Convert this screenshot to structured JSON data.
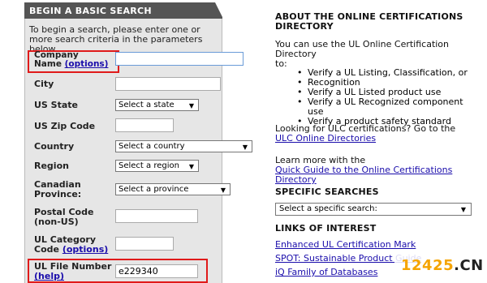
{
  "search_panel": {
    "header": "BEGIN A BASIC SEARCH",
    "intro": "To begin a search, please enter one or more search criteria in the parameters below.",
    "fields": {
      "company_name": {
        "label_line1": "Company",
        "label_line2": "Name",
        "link": "(options)",
        "value": ""
      },
      "city": {
        "label": "City",
        "value": ""
      },
      "us_state": {
        "label": "US State",
        "selected": "Select a state"
      },
      "us_zip": {
        "label": "US Zip Code",
        "value": ""
      },
      "country": {
        "label": "Country",
        "selected": "Select a country"
      },
      "region": {
        "label": "Region",
        "selected": "Select a region"
      },
      "canadian_province": {
        "label_line1": "Canadian",
        "label_line2": "Province:",
        "selected": "Select a province"
      },
      "postal_code": {
        "label_line1": "Postal Code",
        "label_line2": "(non-US)",
        "value": ""
      },
      "ul_category_code": {
        "label_line1": "UL Category",
        "label_line2": "Code",
        "link": "(options)",
        "value": ""
      },
      "ul_file_number": {
        "label": "UL File Number",
        "link": "(help)",
        "value": "e229340"
      }
    }
  },
  "about": {
    "title_line1": "ABOUT THE ONLINE CERTIFICATIONS",
    "title_line2": "DIRECTORY",
    "intro_line1": "You can use the UL Online Certification Directory",
    "intro_line2": "to:",
    "bullets": [
      "Verify a UL Listing, Classification, or",
      "Recognition",
      "Verify a UL Listed product use",
      "Verify a UL Recognized component use",
      "Verify a product safety standard"
    ],
    "ulc_text": "Looking for ULC certifications? Go to the",
    "ulc_link": "ULC Online Directories",
    "learn_text": "Learn more with the",
    "learn_link": "Quick Guide to the Online Certifications Directory"
  },
  "specific_searches": {
    "title": "SPECIFIC SEARCHES",
    "selected": "Select a specific search:"
  },
  "links_of_interest": {
    "title": "LINKS OF INTEREST",
    "links": [
      "Enhanced UL Certification Mark",
      "SPOT: Sustainable Product Guide",
      "iQ Family of Databases"
    ]
  },
  "watermark": {
    "num": "12425",
    "dot": ".",
    "cn": "CN"
  },
  "colors": {
    "header_bg": "#555555",
    "panel_bg": "#e6e6e6",
    "link": "#1a0dab",
    "highlight": "#e01a1a"
  },
  "icons": {
    "dropdown": "chevron-down-icon"
  }
}
